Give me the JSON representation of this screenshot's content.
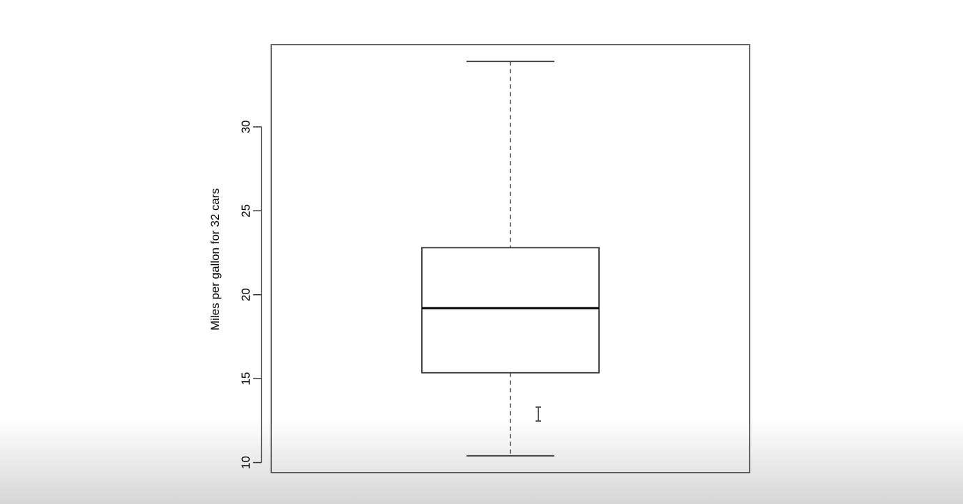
{
  "chart_data": {
    "type": "box",
    "title": "",
    "xlabel": "",
    "ylabel": "Miles per gallon for 32 cars",
    "ylim": [
      9.4,
      34.9
    ],
    "yticks": [
      10,
      15,
      20,
      25,
      30
    ],
    "ytick_labels": [
      "10",
      "15",
      "20",
      "25",
      "30"
    ],
    "box": {
      "whisker_low": 10.4,
      "q1": 15.35,
      "median": 19.2,
      "q3": 22.8,
      "whisker_high": 33.9
    },
    "cursor_glyph": "I",
    "grid": false,
    "legend": "none"
  }
}
